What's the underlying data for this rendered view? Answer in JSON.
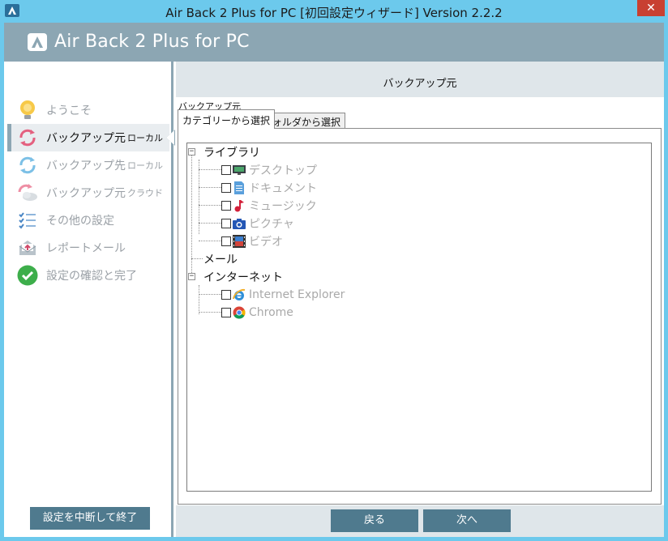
{
  "window": {
    "title": "Air Back 2 Plus for PC [初回設定ウィザード] Version 2.2.2",
    "close_label": "✕"
  },
  "header": {
    "brand": "Air Back 2 Plus for PC"
  },
  "sidebar": {
    "steps": [
      {
        "label": "ようこそ",
        "sub": "",
        "icon": "lightbulb-icon",
        "active": false
      },
      {
        "label": "バックアップ元",
        "sub": "ローカル",
        "icon": "sync-pink-icon",
        "active": true
      },
      {
        "label": "バックアップ先",
        "sub": "ローカル",
        "icon": "sync-blue-icon",
        "active": false
      },
      {
        "label": "バックアップ元",
        "sub": "クラウド",
        "icon": "cloud-sync-icon",
        "active": false
      },
      {
        "label": "その他の設定",
        "sub": "",
        "icon": "checklist-icon",
        "active": false
      },
      {
        "label": "レポートメール",
        "sub": "",
        "icon": "mail-icon",
        "active": false
      },
      {
        "label": "設定の確認と完了",
        "sub": "",
        "icon": "check-circle-icon",
        "active": false
      }
    ],
    "abort_label": "設定を中断して終了"
  },
  "main": {
    "title": "バックアップ元",
    "group_label": "バックアップ元",
    "tabs": [
      {
        "label": "カテゴリーから選択",
        "active": true
      },
      {
        "label": "フォルダから選択",
        "active": false
      }
    ],
    "tree": {
      "library": {
        "label": "ライブラリ",
        "expander": "−"
      },
      "library_children": [
        {
          "label": "デスクトップ",
          "icon": "desktop-icon",
          "checked": false
        },
        {
          "label": "ドキュメント",
          "icon": "document-icon",
          "checked": false
        },
        {
          "label": "ミュージック",
          "icon": "music-note-icon",
          "checked": false
        },
        {
          "label": "ピクチャ",
          "icon": "camera-icon",
          "checked": false
        },
        {
          "label": "ビデオ",
          "icon": "film-icon",
          "checked": false
        }
      ],
      "mail": {
        "label": "メール"
      },
      "internet": {
        "label": "インターネット",
        "expander": "−"
      },
      "internet_children": [
        {
          "label": "Internet Explorer",
          "icon": "internet-explorer-icon",
          "checked": false
        },
        {
          "label": "Chrome",
          "icon": "chrome-icon",
          "checked": false
        }
      ]
    }
  },
  "footer": {
    "back_label": "戻る",
    "next_label": "次へ"
  },
  "colors": {
    "titlebar": "#6cc9ec",
    "header": "#8ca6b3",
    "button": "#4f7a8e",
    "close": "#c84031"
  }
}
